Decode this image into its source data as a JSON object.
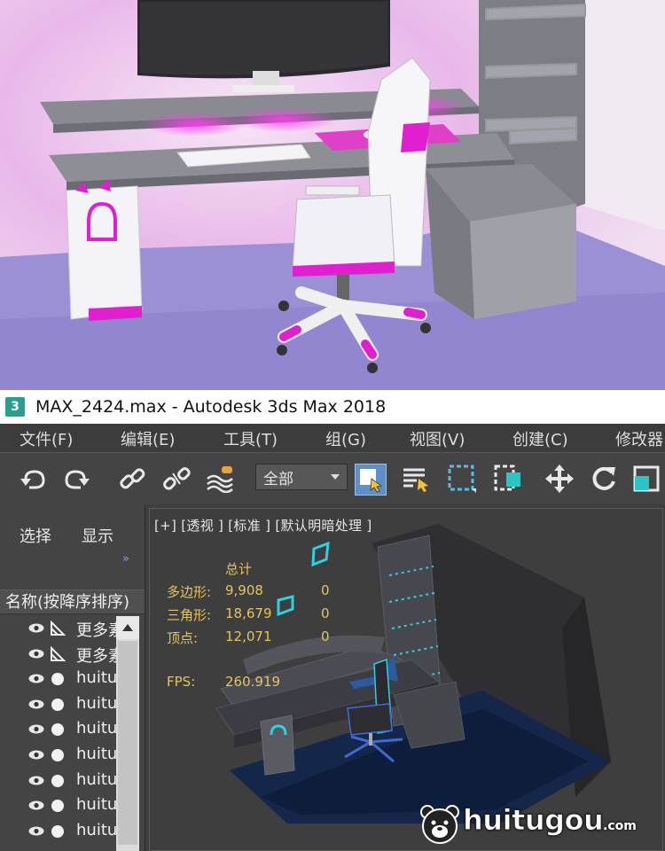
{
  "window": {
    "title": "MAX_2424.max - Autodesk 3ds Max 2018",
    "app_icon": "3ds-max-icon",
    "app_icon_text": "3"
  },
  "menu": [
    "文件(F)",
    "编辑(E)",
    "工具(T)",
    "组(G)",
    "视图(V)",
    "创建(C)",
    "修改器"
  ],
  "toolbar": {
    "icons": [
      "undo-icon",
      "redo-icon",
      "link-icon",
      "unlink-icon",
      "bind-space-warp-icon",
      "select-object-icon",
      "select-by-name-icon",
      "rectangular-selection-icon",
      "window-crossing-icon",
      "move-icon",
      "rotate-icon",
      "scale-icon"
    ],
    "selection_filter": "全部"
  },
  "explorer": {
    "tabs": [
      "选择",
      "显示"
    ],
    "expand": "»",
    "column_header": "名称(按降序排序)",
    "rows": [
      {
        "name": "更多素",
        "type": "helper-icon"
      },
      {
        "name": "更多素",
        "type": "helper-icon"
      },
      {
        "name": "huitu",
        "type": "geometry-icon"
      },
      {
        "name": "huitu",
        "type": "geometry-icon"
      },
      {
        "name": "huitu",
        "type": "geometry-icon"
      },
      {
        "name": "huitu",
        "type": "geometry-icon"
      },
      {
        "name": "huitu",
        "type": "geometry-icon"
      },
      {
        "name": "huitu",
        "type": "geometry-icon"
      },
      {
        "name": "huitu",
        "type": "geometry-icon"
      }
    ]
  },
  "viewport": {
    "label": "[+] [透视 ] [标准 ] [默认明暗处理 ]",
    "stats": {
      "header": "总计",
      "polygons_label": "多边形:",
      "polygons": "9,908",
      "polygons_sel": "0",
      "triangles_label": "三角形:",
      "triangles": "18,679",
      "triangles_sel": "0",
      "vertices_label": "顶点:",
      "vertices": "12,071",
      "vertices_sel": "0",
      "fps_label": "FPS:",
      "fps": "260.919"
    }
  },
  "watermark": {
    "text": "huitugou",
    "domain": ".com",
    "icon": "bear-logo-icon"
  },
  "colors": {
    "accent": "#e020d0",
    "stats": "#e3c55a",
    "wire": "#2fd0e0"
  }
}
